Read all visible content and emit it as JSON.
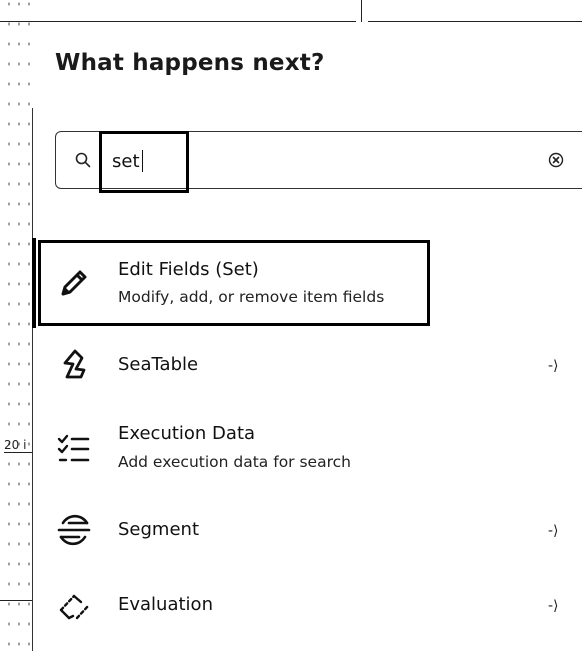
{
  "canvas": {
    "side_label": "20 i"
  },
  "panel": {
    "title": "What happens next?"
  },
  "search": {
    "value": "set",
    "icon": "search-icon",
    "clear_icon": "clear-icon"
  },
  "results": [
    {
      "title": "Edit Fields (Set)",
      "description": "Modify, add, or remove item fields",
      "icon": "pencil-icon",
      "selected": true
    },
    {
      "title": "SeaTable",
      "icon": "seatable-icon",
      "arrow": "-⟩"
    },
    {
      "title": "Execution Data",
      "description": "Add execution data for search",
      "icon": "checklist-icon"
    },
    {
      "title": "Segment",
      "icon": "segment-icon",
      "arrow": "-⟩"
    },
    {
      "title": "Evaluation",
      "icon": "evaluation-icon",
      "arrow": "-⟩"
    }
  ]
}
